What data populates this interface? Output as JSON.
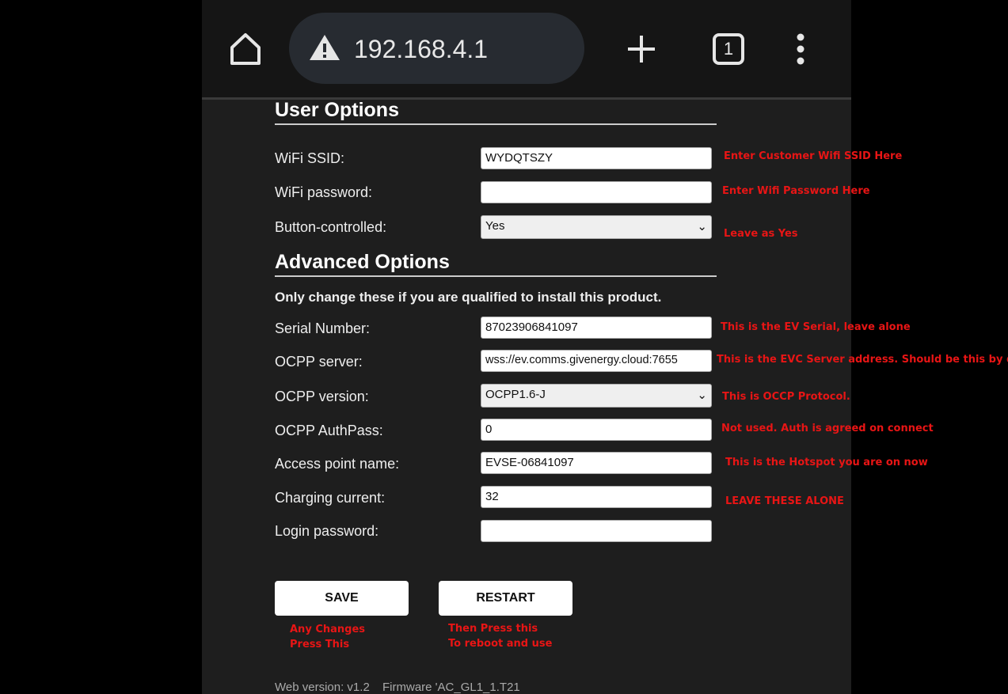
{
  "browser": {
    "url": "192.168.4.1",
    "tab_count": "1"
  },
  "user_options": {
    "heading": "User Options",
    "fields": [
      {
        "label": "WiFi SSID:",
        "value": "WYDQTSZY",
        "note": "Enter Customer Wifi SSID Here"
      },
      {
        "label": "WiFi password:",
        "value": "",
        "note": "Enter Wifi Password Here"
      },
      {
        "label": "Button-controlled:",
        "value": "Yes",
        "note": "Leave as Yes"
      }
    ]
  },
  "advanced_options": {
    "heading": "Advanced Options",
    "warning": "Only change these if you are qualified to install this product.",
    "fields": [
      {
        "label": "Serial Number:",
        "value": "87023906841097",
        "note": "This is the EV Serial, leave alone"
      },
      {
        "label": "OCPP server:",
        "value": "wss://ev.comms.givenergy.cloud:7655",
        "note": "This is the EVC Server address. Should be this by default"
      },
      {
        "label": "OCPP version:",
        "value": "OCPP1.6-J",
        "note": "This is OCCP Protocol."
      },
      {
        "label": "OCPP AuthPass:",
        "value": "0",
        "note": "Not used. Auth is agreed on connect"
      },
      {
        "label": "Access point name:",
        "value": "EVSE-06841097",
        "note": "This is the Hotspot you are on now"
      },
      {
        "label": "Charging current:",
        "value": "32",
        "note": "LEAVE THESE ALONE"
      },
      {
        "label": "Login password:",
        "value": "",
        "note": ""
      }
    ]
  },
  "buttons": {
    "save": "SAVE",
    "restart": "RESTART",
    "save_note_1": "Any Changes",
    "save_note_2": "Press This",
    "restart_note_1": "Then Press this",
    "restart_note_2": "To reboot and use"
  },
  "footer": {
    "web_version": "Web version: v1.2",
    "firmware": "Firmware 'AC_GL1_1.T21"
  }
}
